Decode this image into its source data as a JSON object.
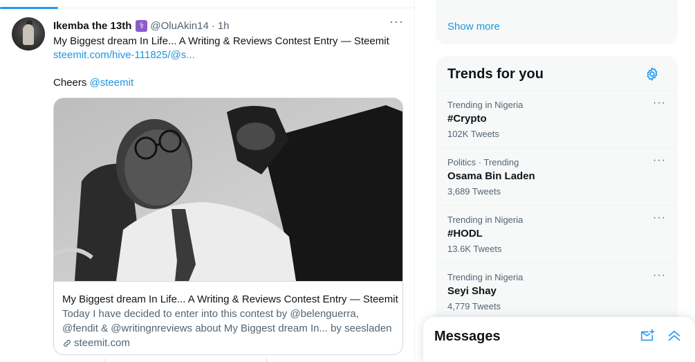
{
  "tweet": {
    "author": "Ikemba the 13th",
    "badge_glyph": "⚕",
    "handle": "@OluAkin14",
    "separator": "·",
    "time": "1h",
    "more": "···",
    "text_line1": "My Biggest dream In Life... A Writing & Reviews Contest Entry — Steemit",
    "link": "steemit.com/hive-111825/@s...",
    "cheers": "Cheers",
    "mention": "@steemit",
    "card": {
      "title": "My Biggest dream In Life... A Writing & Reviews Contest Entry — Steemit",
      "desc_line1": "Today I have decided to enter into this contest by @belenguerra,",
      "desc_line2": "@fendit & @writingnreviews about My Biggest dream In... by seesladen",
      "domain": "steemit.com"
    }
  },
  "sidebar": {
    "show_more": "Show more",
    "trends_title": "Trends for you",
    "trends": [
      {
        "category": "Trending in Nigeria",
        "name": "#Crypto",
        "count": "102K Tweets",
        "more": "···"
      },
      {
        "category": "Politics · Trending",
        "name": "Osama Bin Laden",
        "count": "3,689 Tweets",
        "more": "···"
      },
      {
        "category": "Trending in Nigeria",
        "name": "#HODL",
        "count": "13.6K Tweets",
        "more": "···"
      },
      {
        "category": "Trending in Nigeria",
        "name": "Seyi Shay",
        "count": "4,779 Tweets",
        "more": "···"
      }
    ]
  },
  "messages": {
    "title": "Messages"
  },
  "colors": {
    "accent": "#1d9bf0",
    "link": "#1b95e0",
    "secondary_text": "#536471",
    "panel_bg": "#f7f9f9",
    "badge": "#8b5cc9"
  },
  "icons": [
    "more-icon",
    "verified-badge-icon",
    "link-icon",
    "gear-icon",
    "new-message-icon",
    "collapse-icon"
  ]
}
